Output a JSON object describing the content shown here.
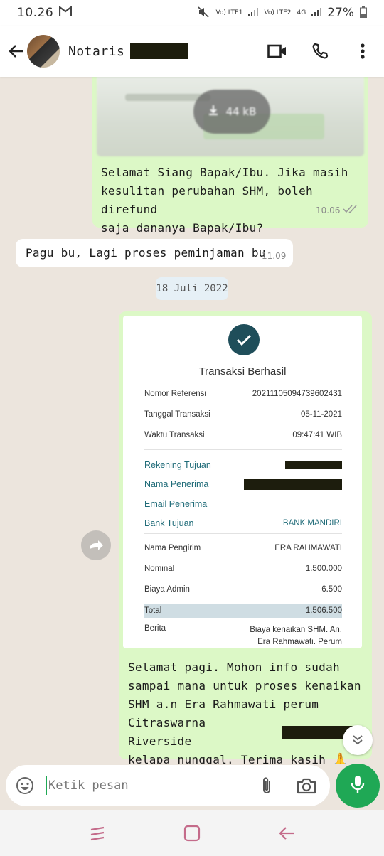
{
  "status_bar": {
    "time": "10.26",
    "notification_icon": "gmail-m",
    "sim1_label": "Vo) LTE1",
    "sim2_label": "Vo) LTE2",
    "network": "4G",
    "battery": "27%"
  },
  "header": {
    "contact_name": "Notaris",
    "icons": [
      "back-arrow-icon",
      "video-call-icon",
      "phone-icon",
      "more-vert-icon"
    ]
  },
  "messages": {
    "msg1": {
      "download_size": "44 kB",
      "text_line1": "Selamat Siang Bapak/Ibu. Jika masih",
      "text_line2": "kesulitan perubahan SHM, boleh direfund",
      "text_line3": "saja dananya Bapak/Ibu?",
      "time": "10.06"
    },
    "msg2": {
      "text": "Pagu bu, Lagi proses peminjaman bu",
      "time": "11.09"
    },
    "date_separator": "18 Juli 2022",
    "receipt": {
      "title": "Transaksi Berhasil",
      "rows": [
        {
          "label": "Nomor Referensi",
          "value": "20211105094739602431"
        },
        {
          "label": "Tanggal Transaksi",
          "value": "05-11-2021"
        },
        {
          "label": "Waktu Transaksi",
          "value": "09:47:41 WIB"
        },
        {
          "label": "Rekening Tujuan",
          "value": ""
        },
        {
          "label": "Nama Penerima",
          "value": ""
        },
        {
          "label": "Email Penerima",
          "value": ""
        },
        {
          "label": "Bank Tujuan",
          "value": "BANK MANDIRI"
        },
        {
          "label": "Nama Pengirim",
          "value": "ERA RAHMAWATI"
        },
        {
          "label": "Nominal",
          "value": "1.500.000"
        },
        {
          "label": "Biaya Admin",
          "value": "6.500"
        },
        {
          "label": "Total",
          "value": "1.506.500"
        },
        {
          "label": "Berita",
          "value_line1": "Biaya kenaikan SHM. An.",
          "value_line2": "Era Rahmawati. Perum"
        }
      ]
    },
    "msg3": {
      "line1": "Selamat pagi. Mohon info sudah",
      "line2": "sampai mana untuk proses kenaikan",
      "line3": "SHM a.n Era Rahmawati perum",
      "line4": "Citraswarna Riverside",
      "line5": "kelapa nunggal. Terima kasih",
      "emoji": "🙏"
    }
  },
  "input": {
    "placeholder": "Ketik pesan"
  },
  "colors": {
    "outgoing_bubble": "#dcf8c6",
    "incoming_bubble": "#ffffff",
    "chat_background": "#ece5dd",
    "accent_green": "#1fa855",
    "receipt_teal": "#1f6b78"
  }
}
